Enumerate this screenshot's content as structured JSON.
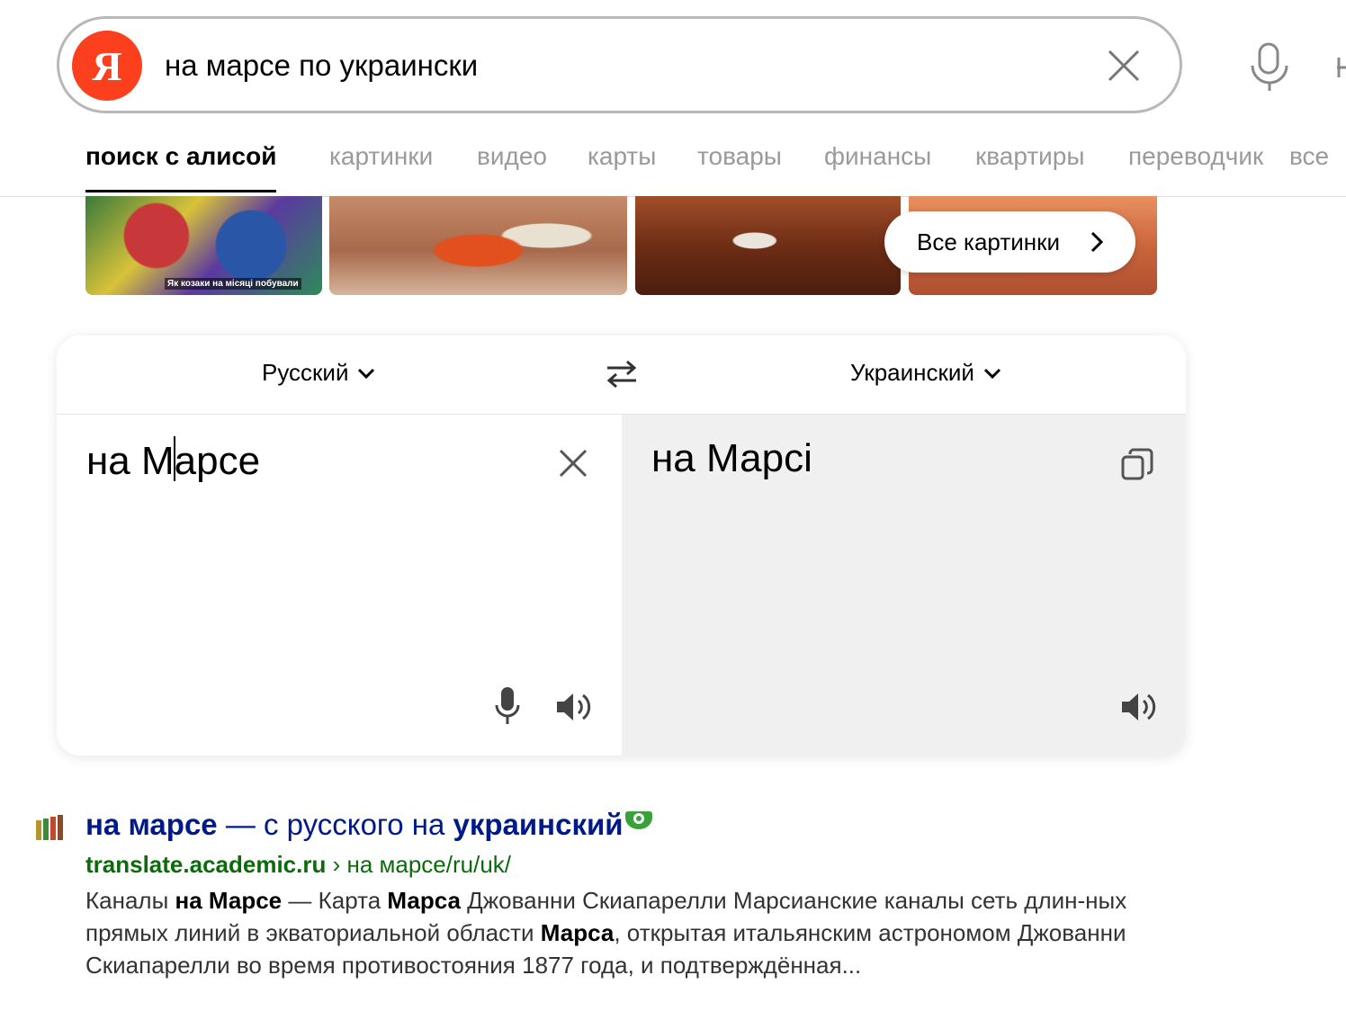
{
  "search": {
    "logo_letter": "Я",
    "query": "на марсе по украински",
    "icons": [
      "yandex-logo",
      "clear-icon",
      "microphone-icon"
    ]
  },
  "tabs": [
    {
      "label": "поиск с алисой",
      "active": true
    },
    {
      "label": "картинки",
      "active": false
    },
    {
      "label": "видео",
      "active": false
    },
    {
      "label": "карты",
      "active": false
    },
    {
      "label": "товары",
      "active": false
    },
    {
      "label": "финансы",
      "active": false
    },
    {
      "label": "квартиры",
      "active": false
    },
    {
      "label": "переводчик",
      "active": false
    },
    {
      "label": "все",
      "active": false
    }
  ],
  "images": {
    "thumb1_caption": "Як козаки на місяці побували",
    "all_images_label": "Все картинки"
  },
  "translator": {
    "source_lang": "Русский",
    "target_lang": "Украинский",
    "source_text_before_caret": "на М",
    "source_text_after_caret": "арсе",
    "target_text": "на Марсі"
  },
  "result": {
    "title_bold_1": "на марсе",
    "title_middle": " — с русского на ",
    "title_bold_2": "украинский",
    "url_domain": "translate.academic.ru",
    "url_path": " › на марсе/ru/uk/",
    "snippet": [
      {
        "text": "Каналы ",
        "bold": false
      },
      {
        "text": "на Марсе",
        "bold": true
      },
      {
        "text": " — Карта ",
        "bold": false
      },
      {
        "text": "Марса",
        "bold": true
      },
      {
        "text": " Джованни Скиапарелли Марсианские каналы сеть длин-ных прямых линий в экваториальной области ",
        "bold": false
      },
      {
        "text": "Марса",
        "bold": true
      },
      {
        "text": ", открытая итальянским астрономом Джованни Скиапарелли во время противостояния 1877 года, и подтверждённая...",
        "bold": false
      }
    ]
  },
  "colors": {
    "logo_red": "#fc3f1d",
    "result_title": "#001a8a",
    "result_url": "#0b6b0b",
    "tab_inactive": "#9a9a9a",
    "target_pane_bg": "#f0f0f0"
  }
}
